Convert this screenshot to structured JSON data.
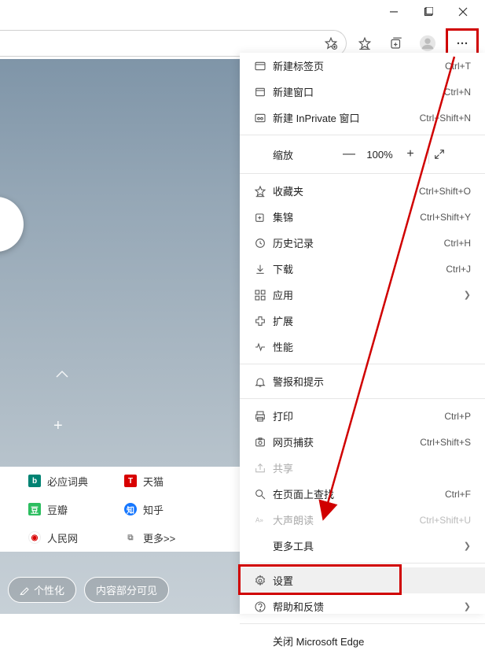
{
  "window_controls": {
    "minimize": "—",
    "maximize": "▢",
    "close": "✕"
  },
  "toolbar": {
    "more": "⋯"
  },
  "zoom": {
    "label": "缩放",
    "minus": "—",
    "pct": "100%",
    "plus": "+",
    "full": "⤢"
  },
  "menu": {
    "g1": [
      {
        "icon": "tab",
        "label": "新建标签页",
        "short": "Ctrl+T"
      },
      {
        "icon": "window",
        "label": "新建窗口",
        "short": "Ctrl+N"
      },
      {
        "icon": "inprivate",
        "label": "新建 InPrivate 窗口",
        "short": "Ctrl+Shift+N"
      }
    ],
    "g2": [
      {
        "icon": "star",
        "label": "收藏夹",
        "short": "Ctrl+Shift+O"
      },
      {
        "icon": "collections",
        "label": "集锦",
        "short": "Ctrl+Shift+Y"
      },
      {
        "icon": "history",
        "label": "历史记录",
        "short": "Ctrl+H"
      },
      {
        "icon": "download",
        "label": "下载",
        "short": "Ctrl+J"
      },
      {
        "icon": "apps",
        "label": "应用",
        "short": "",
        "sub": true
      },
      {
        "icon": "ext",
        "label": "扩展",
        "short": ""
      },
      {
        "icon": "perf",
        "label": "性能",
        "short": ""
      }
    ],
    "g3": [
      {
        "icon": "bell",
        "label": "警报和提示",
        "short": ""
      }
    ],
    "g4": [
      {
        "icon": "print",
        "label": "打印",
        "short": "Ctrl+P"
      },
      {
        "icon": "capture",
        "label": "网页捕获",
        "short": "Ctrl+Shift+S"
      },
      {
        "icon": "share",
        "label": "共享",
        "short": "",
        "disabled": true
      },
      {
        "icon": "find",
        "label": "在页面上查找",
        "short": "Ctrl+F"
      },
      {
        "icon": "read",
        "label": "大声朗读",
        "short": "Ctrl+Shift+U",
        "disabled": true
      },
      {
        "icon": "",
        "label": "更多工具",
        "short": "",
        "sub": true
      }
    ],
    "g5": [
      {
        "icon": "gear",
        "label": "设置",
        "short": "",
        "highlight": true
      },
      {
        "icon": "help",
        "label": "帮助和反馈",
        "short": "",
        "sub": true
      }
    ],
    "g6": [
      {
        "icon": "",
        "label": "关闭 Microsoft Edge",
        "short": ""
      }
    ]
  },
  "links": {
    "r1a": "必应词典",
    "r1b": "天猫",
    "r2a": "豆瓣",
    "r2b": "知乎",
    "r3a": "人民网",
    "r3b": "更多>>"
  },
  "pills": {
    "a": "个性化",
    "b": "内容部分可见"
  }
}
